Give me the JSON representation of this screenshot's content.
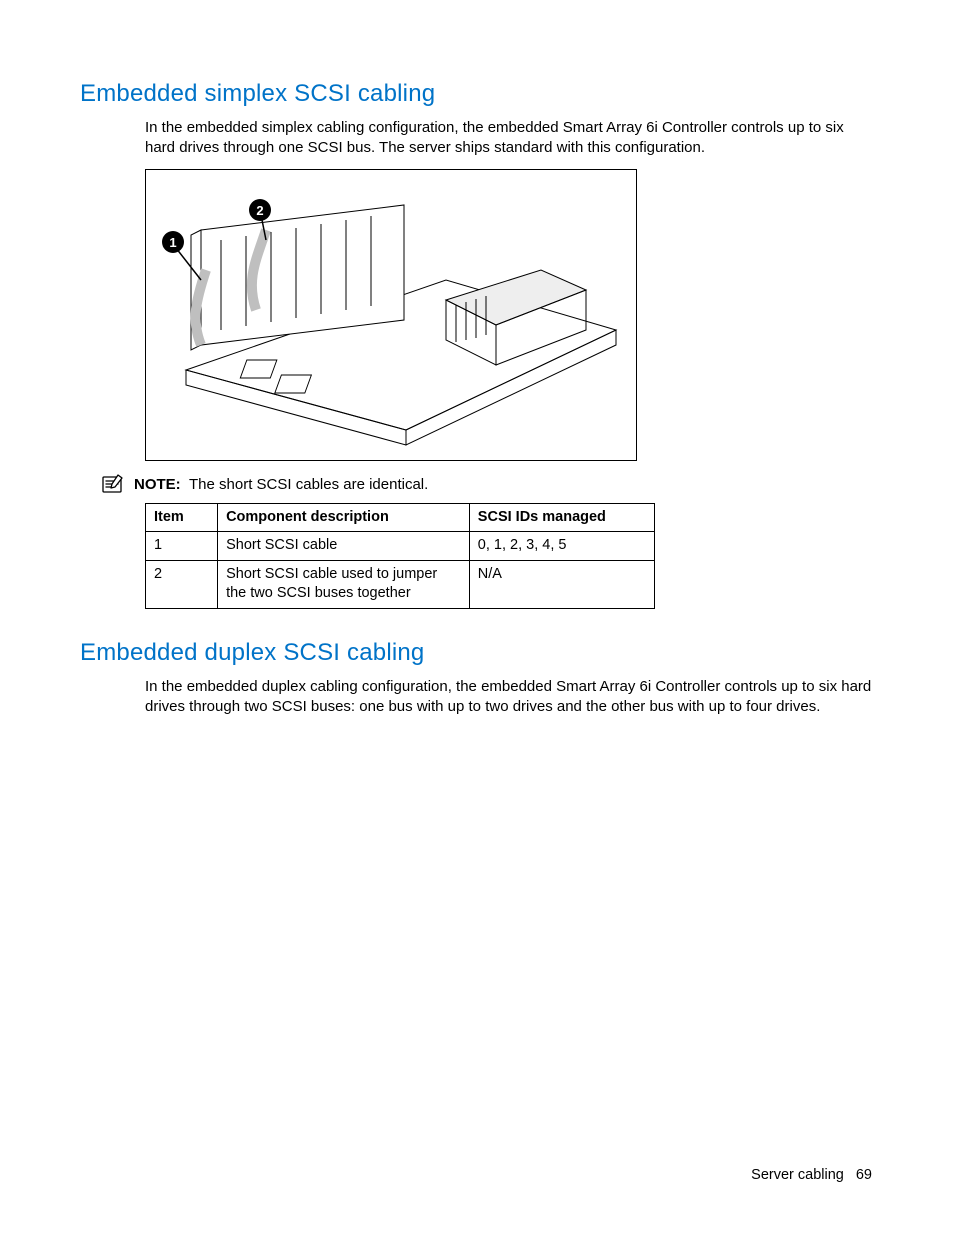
{
  "sections": {
    "simplex": {
      "title": "Embedded simplex SCSI cabling",
      "para": "In the embedded simplex cabling configuration, the embedded Smart Array 6i Controller controls up to six hard drives through one SCSI bus. The server ships standard with this configuration."
    },
    "duplex": {
      "title": "Embedded duplex SCSI cabling",
      "para": "In the embedded duplex cabling configuration, the embedded Smart Array 6i Controller controls up to six hard drives through two SCSI buses: one bus with up to two drives and the other bus with up to four drives."
    }
  },
  "note": {
    "label": "NOTE:",
    "text": "The short SCSI cables are identical."
  },
  "table": {
    "headers": {
      "item": "Item",
      "desc": "Component description",
      "ids": "SCSI IDs managed"
    },
    "rows": [
      {
        "item": "1",
        "desc": "Short SCSI cable",
        "ids": "0, 1, 2, 3, 4, 5"
      },
      {
        "item": "2",
        "desc": "Short SCSI cable used to jumper the two SCSI buses together",
        "ids": "N/A"
      }
    ]
  },
  "diagram": {
    "callouts": [
      "1",
      "2"
    ]
  },
  "footer": {
    "section": "Server cabling",
    "page": "69"
  }
}
